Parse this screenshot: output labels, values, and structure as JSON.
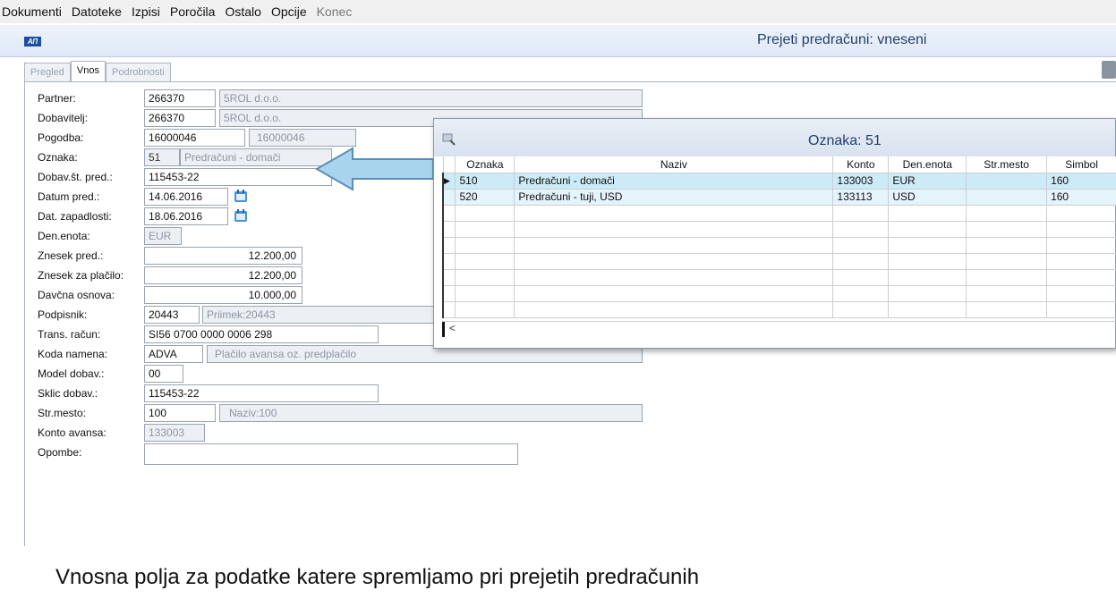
{
  "menu": {
    "items": [
      "Dokumenti",
      "Datoteke",
      "Izpisi",
      "Poročila",
      "Ostalo",
      "Opcije"
    ],
    "disabled_item": "Konec"
  },
  "header": {
    "logo_text": "АП",
    "title": "Prejeti predračuni: vneseni"
  },
  "tabs": [
    {
      "label": "Pregled",
      "active": false
    },
    {
      "label": "Vnos",
      "active": true
    },
    {
      "label": "Podrobnosti",
      "active": false
    }
  ],
  "form": {
    "partner": {
      "label": "Partner:",
      "code": "266370",
      "name": "5ROL d.o.o."
    },
    "dobavitelj": {
      "label": "Dobavitelj:",
      "code": "266370",
      "name": "5ROL d.o.o."
    },
    "pogodba": {
      "label": "Pogodba:",
      "code": "16000046",
      "name": "16000046"
    },
    "oznaka": {
      "label": "Oznaka:",
      "code": "51",
      "name": "Predračuni - domači"
    },
    "dobav_st_pred": {
      "label": "Dobav.št. pred.:",
      "value": "115453-22"
    },
    "datum_pred": {
      "label": "Datum pred.:",
      "value": "14.06.2016"
    },
    "dat_zapadlosti": {
      "label": "Dat. zapadlosti:",
      "value": "18.06.2016"
    },
    "den_enota": {
      "label": "Den.enota:",
      "value": "EUR"
    },
    "znesek_pred": {
      "label": "Znesek pred.:",
      "value": "12.200,00"
    },
    "znesek_za_placilo": {
      "label": "Znesek za plačilo:",
      "value": "12.200,00"
    },
    "davcna_osnova": {
      "label": "Davčna osnova:",
      "value": "10.000,00"
    },
    "podpisnik": {
      "label": "Podpisnik:",
      "code": "20443",
      "name": "Priimek:20443"
    },
    "trans_racun": {
      "label": "Trans. račun:",
      "value": "SI56 0700 0000 0006 298"
    },
    "koda_namena": {
      "label": "Koda namena:",
      "code": "ADVA",
      "name": "Plačilo avansa oz. predplačilo"
    },
    "model_dobav": {
      "label": "Model dobav.:",
      "value": "00"
    },
    "sklic_dobav": {
      "label": "Sklic dobav.:",
      "value": "115453-22"
    },
    "str_mesto": {
      "label": "Str.mesto:",
      "code": "100",
      "name": "Naziv:100"
    },
    "konto_avansa": {
      "label": "Konto avansa:",
      "value": "133003"
    },
    "opombe": {
      "label": "Opombe:",
      "value": ""
    }
  },
  "popup": {
    "title": "Oznaka:  51",
    "columns": [
      "Oznaka",
      "Naziv",
      "Konto",
      "Den.enota",
      "Str.mesto",
      "Simbol"
    ],
    "rows": [
      [
        "510",
        "Predračuni - domači",
        "133003",
        "EUR",
        "",
        "160"
      ],
      [
        "520",
        "Predračuni - tuji, USD",
        "133113",
        "USD",
        "",
        "160"
      ]
    ],
    "scroll_left": "<"
  },
  "colors": {
    "arrow_fill": "#a8d4ee",
    "arrow_stroke": "#5b8db8",
    "selected_row": "#cdebf7"
  },
  "caption": "Vnosna polja za podatke katere spremljamo pri prejetih predračunih"
}
